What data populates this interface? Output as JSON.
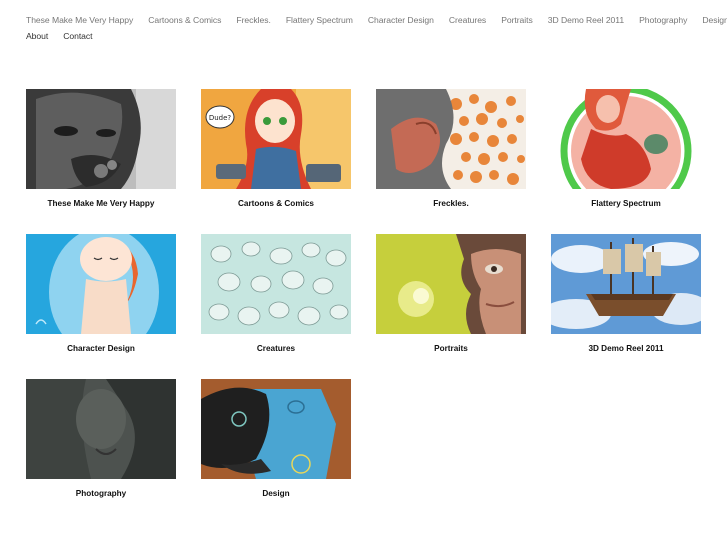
{
  "nav": {
    "row1": [
      "These Make Me Very Happy",
      "Cartoons & Comics",
      "Freckles.",
      "Flattery Spectrum",
      "Character Design",
      "Creatures",
      "Portraits",
      "3D Demo Reel 2011",
      "Photography",
      "Design"
    ],
    "row2": [
      "About",
      "Contact"
    ]
  },
  "gallery": {
    "items": [
      {
        "caption": "These Make Me Very Happy"
      },
      {
        "caption": "Cartoons & Comics"
      },
      {
        "caption": "Freckles."
      },
      {
        "caption": "Flattery Spectrum"
      },
      {
        "caption": "Character Design"
      },
      {
        "caption": "Creatures"
      },
      {
        "caption": "Portraits"
      },
      {
        "caption": "3D Demo Reel 2011"
      },
      {
        "caption": "Photography"
      },
      {
        "caption": "Design"
      }
    ]
  },
  "artwork_text": {
    "speech_bubble": "Dude?"
  },
  "colors": {
    "nav_text": "#777777",
    "caption_text": "#111111",
    "background": "#ffffff"
  }
}
